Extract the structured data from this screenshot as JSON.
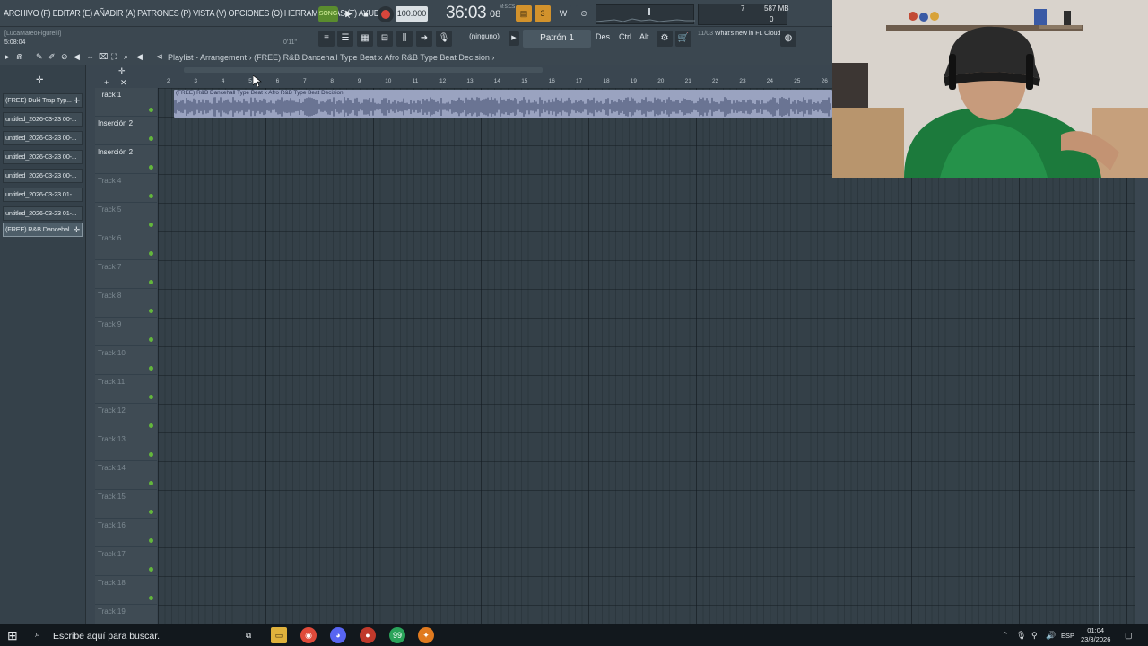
{
  "menu": {
    "text": "ARCHIVO (F) EDITAR (E) AÑADIR (A) PATRONES (P) VISTA (V) OPCIONES (O) HERRAMIENTAS (T) AYUDA"
  },
  "transport": {
    "song_label": "SONG",
    "tempo": "100.000",
    "time_main": "36:03",
    "time_sub": "08",
    "ms_label": "M:S:CS",
    "cpu": "7",
    "memory": "587 MB",
    "voices": "0"
  },
  "project": {
    "user": "[LucaMateoFigurelli]",
    "elapsed": "5:08:04",
    "position": "0'11\""
  },
  "pattern": {
    "snap": "(ninguno)",
    "name": "Patrón 1",
    "des": "Des.",
    "ctrl": "Ctrl",
    "alt": "Alt"
  },
  "news": {
    "date": "11/03",
    "text": "What's new in FL Cloud Pro?"
  },
  "playlist": {
    "title": "Playlist - Arrangement",
    "separator": "›",
    "project_name": "(FREE) R&B Dancehall Type Beat x Afro R&B Type Beat Decision",
    "arrow": "›"
  },
  "browser": {
    "items": [
      "(FREE) Duki Trap Typ...",
      "untitled_2026-03-23 00-...",
      "untitled_2026-03-23 00-...",
      "untitled_2026-03-23 00-...",
      "untitled_2026-03-23 00-...",
      "untitled_2026-03-23 01-...",
      "untitled_2026-03-23 01-...",
      "(FREE) R&B Dancehal..."
    ]
  },
  "ruler": [
    "2",
    "3",
    "4",
    "5",
    "6",
    "7",
    "8",
    "9",
    "10",
    "11",
    "12",
    "13",
    "14",
    "15",
    "16",
    "17",
    "18",
    "19",
    "20",
    "21",
    "22",
    "23",
    "24",
    "25",
    "26"
  ],
  "clip": {
    "label": "(FREE) R&B Dancehall Type Beat x Afro R&B Type Beat Decision"
  },
  "tracks": [
    {
      "name": "Track 1",
      "active": true
    },
    {
      "name": "Inserción 2",
      "active": true
    },
    {
      "name": "Inserción 2",
      "active": true
    },
    {
      "name": "Track 4",
      "active": false
    },
    {
      "name": "Track 5",
      "active": false
    },
    {
      "name": "Track 6",
      "active": false
    },
    {
      "name": "Track 7",
      "active": false
    },
    {
      "name": "Track 8",
      "active": false
    },
    {
      "name": "Track 9",
      "active": false
    },
    {
      "name": "Track 10",
      "active": false
    },
    {
      "name": "Track 11",
      "active": false
    },
    {
      "name": "Track 12",
      "active": false
    },
    {
      "name": "Track 13",
      "active": false
    },
    {
      "name": "Track 14",
      "active": false
    },
    {
      "name": "Track 15",
      "active": false
    },
    {
      "name": "Track 16",
      "active": false
    },
    {
      "name": "Track 17",
      "active": false
    },
    {
      "name": "Track 18",
      "active": false
    },
    {
      "name": "Track 19",
      "active": false
    }
  ],
  "taskbar": {
    "search_placeholder": "Escribe aquí para buscar.",
    "lang": "ESP",
    "time": "01:04",
    "date": "23/3/2026",
    "whatsapp_badge": "99"
  },
  "colors": {
    "accent": "#d2922c",
    "song": "#5a8c2e",
    "record": "#d8463c",
    "track_led": "#63b63c",
    "clip": "#9aa3c0"
  }
}
